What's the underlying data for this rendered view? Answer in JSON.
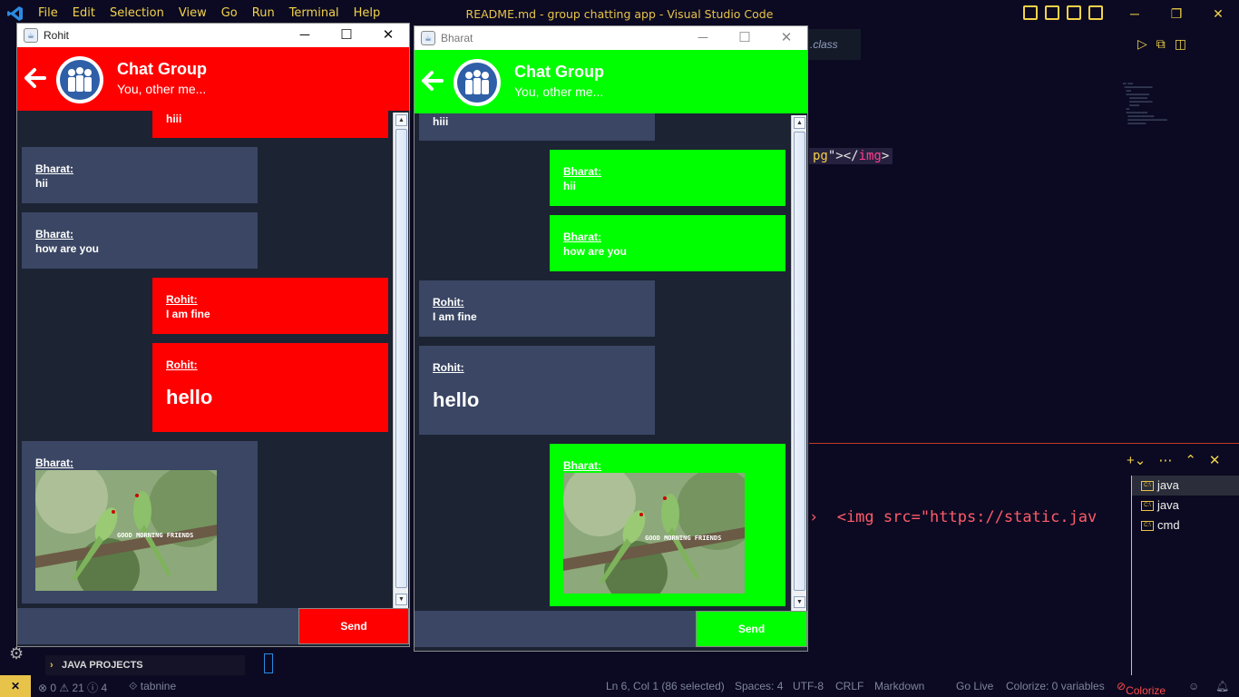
{
  "vscode": {
    "menu": [
      "File",
      "Edit",
      "Selection",
      "View",
      "Go",
      "Run",
      "Terminal",
      "Help"
    ],
    "title": "README.md - group chatting app - Visual Studio Code",
    "tab_label": ".class",
    "code_line": {
      "str": "pg",
      "mid": "\"></",
      "tag": "img",
      "end": ">"
    },
    "terminal_text": "›  <img src=\"https://static.jav",
    "terminal_list": [
      {
        "label": "java",
        "active": true
      },
      {
        "label": "java",
        "active": false
      },
      {
        "label": "cmd",
        "active": false
      }
    ],
    "java_projects": "JAVA PROJECTS",
    "status": {
      "problems": "⊗ 0 ⚠ 21 ⓘ 4",
      "tabnine": "⟐ tabnine",
      "position": "Ln 6, Col 1 (86 selected)",
      "spaces": "Spaces: 4",
      "encoding": "UTF-8",
      "eol": "CRLF",
      "language": "Markdown",
      "golive": "Go Live",
      "colorize_vars": "Colorize: 0 variables",
      "colorize": "Colorize"
    },
    "accent": "#e8c34a"
  },
  "rohit_window": {
    "title": "Rohit",
    "accent": "#ff0000",
    "header_title": "Chat Group",
    "header_subtitle": "You, other me...",
    "messages": [
      {
        "author": "",
        "text": "hiii",
        "own": true
      },
      {
        "author": "Bharat:",
        "text": "hii",
        "own": false
      },
      {
        "author": "Bharat:",
        "text": "how are you",
        "own": false
      },
      {
        "author": "Rohit:",
        "text": "I am fine",
        "own": true
      },
      {
        "author": "Rohit:",
        "text": "hello",
        "own": true
      },
      {
        "author": "Bharat:",
        "image_caption": "GOOD MORNING FRIENDS",
        "own": false
      }
    ],
    "send_label": "Send"
  },
  "bharat_window": {
    "title": "Bharat",
    "accent": "#00ff00",
    "header_title": "Chat Group",
    "header_subtitle": "You, other me...",
    "messages": [
      {
        "author": "",
        "text": "hiii",
        "own": false
      },
      {
        "author": "Bharat:",
        "text": "hii",
        "own": true
      },
      {
        "author": "Bharat:",
        "text": "how are you",
        "own": true
      },
      {
        "author": "Rohit:",
        "text": "I am fine",
        "own": false
      },
      {
        "author": "Rohit:",
        "text": "hello",
        "own": false
      },
      {
        "author": "Bharat:",
        "image_caption": "GOOD MORNING FRIENDS",
        "own": true
      }
    ],
    "send_label": "Send"
  }
}
